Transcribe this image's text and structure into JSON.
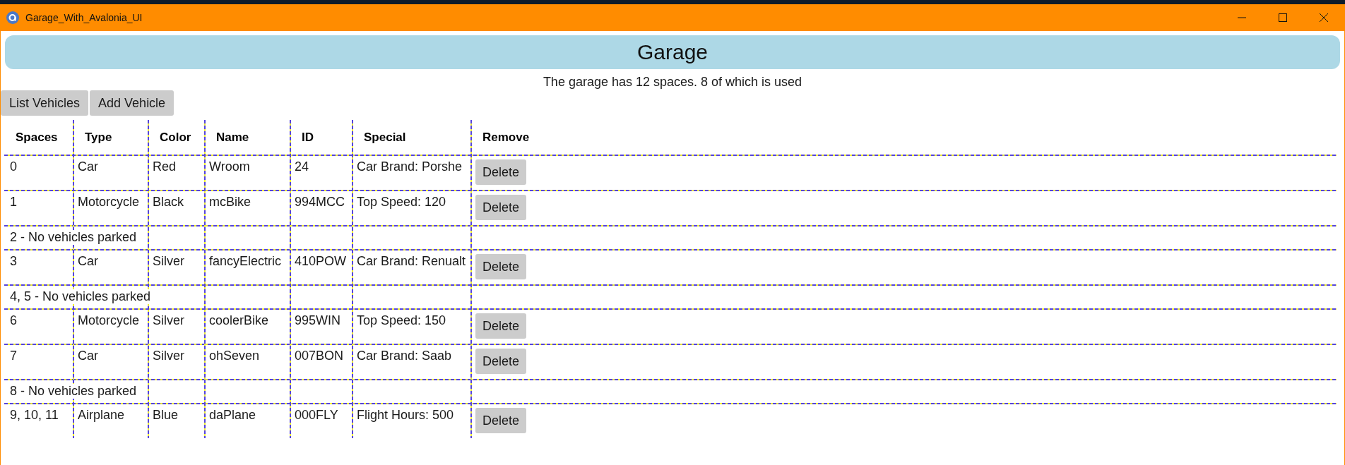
{
  "window": {
    "title": "Garage_With_Avalonia_UI"
  },
  "header": {
    "title": "Garage",
    "summary": "The garage has 12 spaces. 8 of which is used"
  },
  "toolbar": {
    "buttons": [
      "List Vehicles",
      "Add Vehicle"
    ]
  },
  "table": {
    "columns": [
      "Spaces",
      "Type",
      "Color",
      "Name",
      "ID",
      "Special",
      "Remove"
    ],
    "rows": [
      {
        "kind": "vehicle",
        "cells": [
          "0",
          "Car",
          "Red",
          "Wroom",
          "24",
          "Car Brand: Porshe"
        ],
        "action": "Delete"
      },
      {
        "kind": "vehicle",
        "cells": [
          "1",
          "Motorcycle",
          "Black",
          "mcBike",
          "994MCC",
          "Top Speed: 120"
        ],
        "action": "Delete"
      },
      {
        "kind": "empty",
        "text": "2 - No vehicles parked"
      },
      {
        "kind": "vehicle",
        "cells": [
          "3",
          "Car",
          "Silver",
          "fancyElectric",
          "410POW",
          "Car Brand: Renualt"
        ],
        "action": "Delete"
      },
      {
        "kind": "empty",
        "text": "4, 5 - No vehicles parked"
      },
      {
        "kind": "vehicle",
        "cells": [
          "6",
          "Motorcycle",
          "Silver",
          "coolerBike",
          "995WIN",
          "Top Speed: 150"
        ],
        "action": "Delete"
      },
      {
        "kind": "vehicle",
        "cells": [
          "7",
          "Car",
          "Silver",
          "ohSeven",
          "007BON",
          "Car Brand: Saab"
        ],
        "action": "Delete"
      },
      {
        "kind": "empty",
        "text": "8 - No vehicles parked"
      },
      {
        "kind": "vehicle",
        "cells": [
          "9, 10, 11",
          "Airplane",
          "Blue",
          "daPlane",
          "000FLY",
          "Flight Hours: 500"
        ],
        "action": "Delete"
      }
    ]
  }
}
